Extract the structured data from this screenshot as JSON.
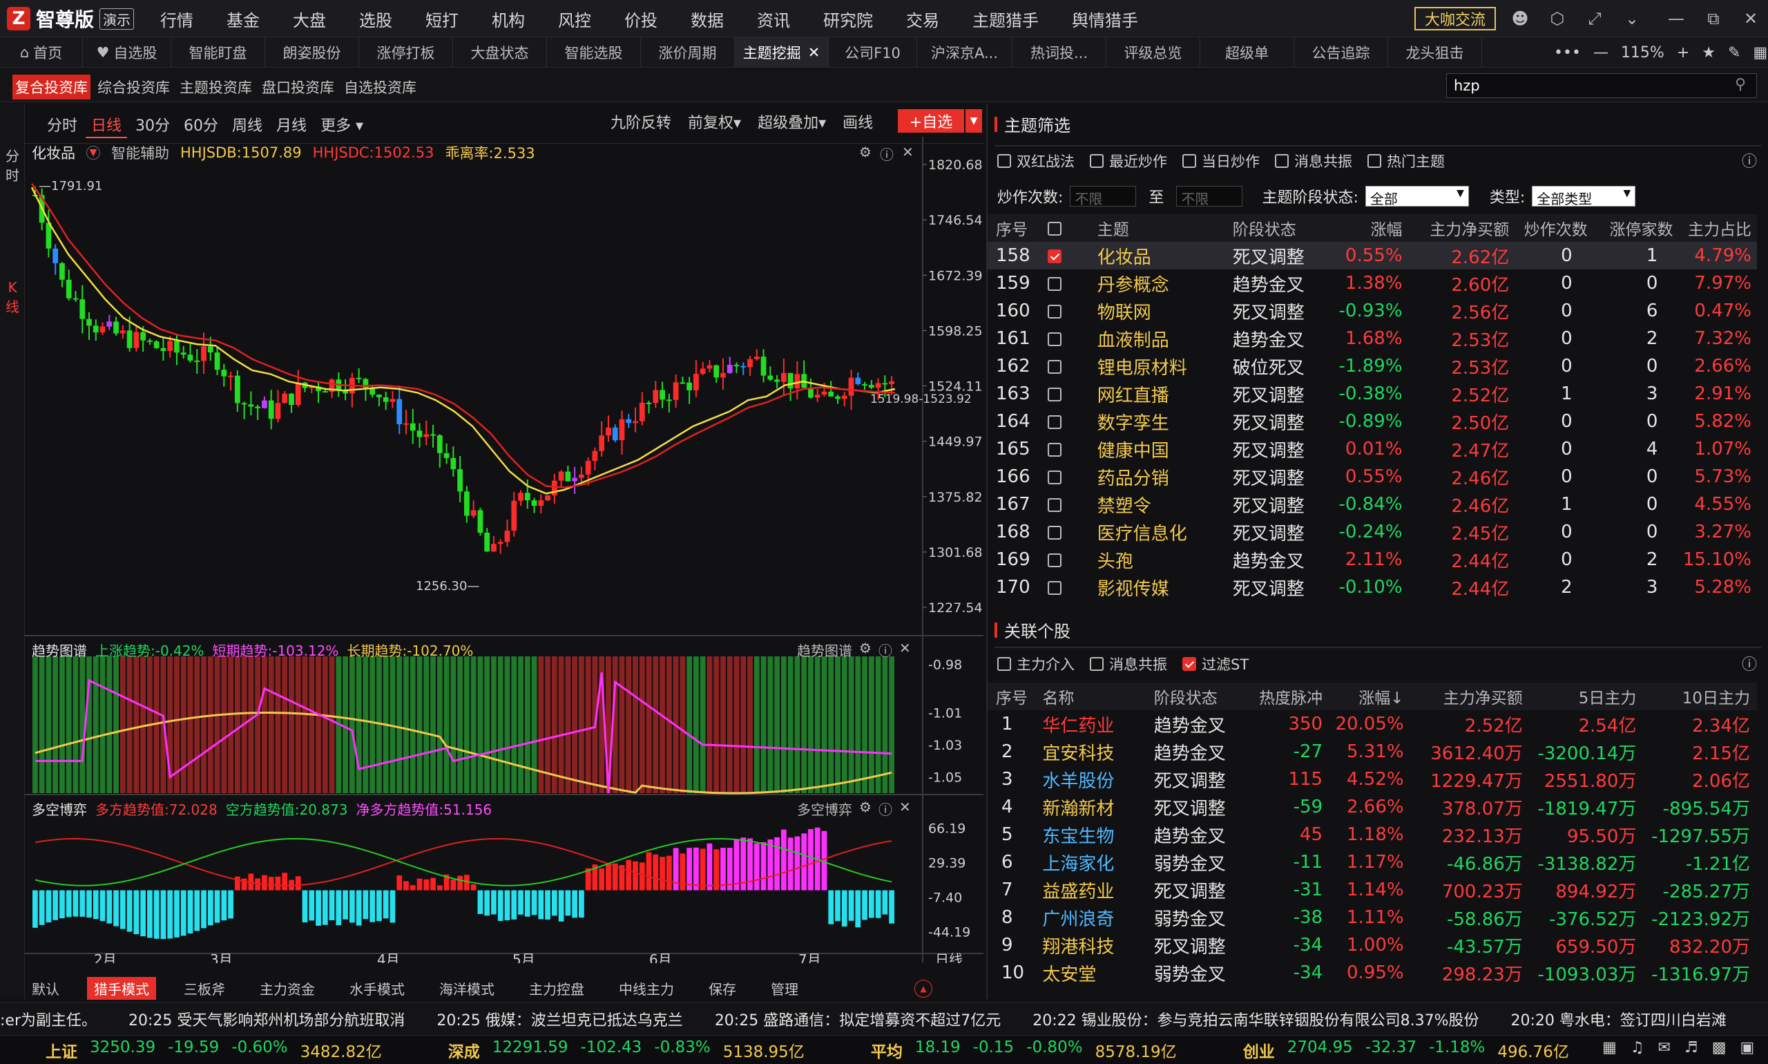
{
  "app": {
    "name": "智尊版",
    "badge": "演示",
    "coffee": "大咖交流"
  },
  "main_menu": [
    "行情",
    "基金",
    "大盘",
    "选股",
    "短打",
    "机构",
    "风控",
    "价投",
    "数据",
    "资讯",
    "研究院",
    "交易",
    "主题猎手",
    "舆情猎手"
  ],
  "tabs": [
    "首页",
    "自选股",
    "智能盯盘",
    "朗姿股份",
    "涨停打板",
    "大盘状态",
    "智能选股",
    "涨价周期",
    "主题挖掘",
    "公司F10",
    "沪深京A...",
    "热词投...",
    "评级总览",
    "超级单",
    "公告追踪",
    "龙头狙击"
  ],
  "active_tab": "主题挖掘",
  "zoom": "115%",
  "lib_tabs": [
    "复合投资库",
    "综合投资库",
    "主题投资库",
    "盘口投资库",
    "自选投资库"
  ],
  "search_value": "hzp",
  "left_labels": {
    "fenshi": "分时",
    "kline": "K线"
  },
  "periods": [
    "分时",
    "日线",
    "30分",
    "60分",
    "周线",
    "月线",
    "更多 ▾"
  ],
  "chart_tools": [
    "九阶反转",
    "前复权▾",
    "超级叠加▾",
    "画线"
  ],
  "add_watch": "+自选",
  "info": {
    "name": "化妆品",
    "assist": "智能辅助",
    "hhjsdb": "HHJSDB:1507.89",
    "hhjsdc": "HHJSDC:1502.53",
    "deviation": "乖离率:2.533"
  },
  "chart_data": [
    {
      "type": "candlestick",
      "title": "化妆品",
      "y_ticks": [
        "1820.68",
        "1746.54",
        "1672.39",
        "1598.25",
        "1524.11",
        "1449.97",
        "1375.82",
        "1301.68",
        "1227.54"
      ],
      "ylim": [
        1210,
        1830
      ],
      "x_ticks": [
        "2月",
        "3月",
        "4月",
        "5月",
        "6月",
        "7月",
        "日线"
      ],
      "annotations": [
        "1791.91",
        "1256.30",
        "1519.98-1523.92"
      ],
      "series": [
        {
          "name": "HHJSDB",
          "points": [
            1790,
            1740,
            1700,
            1670,
            1640,
            1615,
            1600,
            1590,
            1585,
            1580,
            1578,
            1560,
            1545,
            1540,
            1530,
            1525,
            1520,
            1518,
            1520,
            1522,
            1520,
            1515,
            1505,
            1490,
            1470,
            1440,
            1410,
            1390,
            1380,
            1385,
            1395,
            1405,
            1415,
            1425,
            1440,
            1455,
            1470,
            1480,
            1490,
            1505,
            1510,
            1525,
            1530,
            1525,
            1520,
            1518,
            1515,
            1520
          ]
        },
        {
          "name": "HHJSDC",
          "points": [
            1795,
            1760,
            1720,
            1690,
            1660,
            1635,
            1615,
            1600,
            1592,
            1588,
            1585,
            1575,
            1560,
            1550,
            1540,
            1532,
            1528,
            1525,
            1524,
            1525,
            1523,
            1520,
            1512,
            1500,
            1482,
            1460,
            1430,
            1405,
            1390,
            1388,
            1392,
            1400,
            1408,
            1418,
            1430,
            1445,
            1458,
            1470,
            1482,
            1495,
            1502,
            1512,
            1520,
            1522,
            1520,
            1518,
            1516,
            1515
          ]
        }
      ]
    },
    {
      "type": "bar",
      "title": "趋势图谱",
      "legend": [
        "上涨趋势:-0.42%",
        "短期趋势:-103.12%",
        "长期趋势:-102.70%"
      ],
      "y_ticks": [
        "-0.98",
        "-1.01",
        "-1.03",
        "-1.05"
      ]
    },
    {
      "type": "bar",
      "title": "多空博弈",
      "legend": [
        "多方趋势值:72.028",
        "空方趋势值:20.873",
        "净多方趋势值:51.156"
      ],
      "y_ticks": [
        "66.19",
        "29.39",
        "-7.40",
        "-44.19"
      ]
    }
  ],
  "bottom_tabs": [
    "默认",
    "猎手模式",
    "三板斧",
    "主力资金",
    "水手模式",
    "海洋模式",
    "主力控盘",
    "中线主力",
    "保存",
    "管理"
  ],
  "active_bottom_tab": "猎手模式",
  "theme_filter": {
    "title": "主题筛选",
    "checkboxes": [
      "双红战法",
      "最近炒作",
      "当日炒作",
      "消息共振",
      "热门主题"
    ],
    "count_label": "炒作次数:",
    "min_placeholder": "不限",
    "to": "至",
    "max_placeholder": "不限",
    "stage_label": "主题阶段状态:",
    "stage_value": "全部",
    "type_label": "类型:",
    "type_value": "全部类型",
    "headers": [
      "序号",
      "",
      "主题",
      "阶段状态",
      "涨幅",
      "主力净买额",
      "炒作次数",
      "涨停家数",
      "主力占比"
    ],
    "rows": [
      {
        "no": "158",
        "checked": true,
        "name": "化妆品",
        "stage": "死叉调整",
        "chg": "0.55%",
        "net": "2.62亿",
        "times": "0",
        "limit": "1",
        "ratio": "4.79%"
      },
      {
        "no": "159",
        "checked": false,
        "name": "丹参概念",
        "stage": "趋势金叉",
        "chg": "1.38%",
        "net": "2.60亿",
        "times": "0",
        "limit": "0",
        "ratio": "7.97%"
      },
      {
        "no": "160",
        "checked": false,
        "name": "物联网",
        "stage": "死叉调整",
        "chg": "-0.93%",
        "net": "2.56亿",
        "times": "0",
        "limit": "6",
        "ratio": "0.47%"
      },
      {
        "no": "161",
        "checked": false,
        "name": "血液制品",
        "stage": "趋势金叉",
        "chg": "1.68%",
        "net": "2.53亿",
        "times": "0",
        "limit": "2",
        "ratio": "7.32%"
      },
      {
        "no": "162",
        "checked": false,
        "name": "锂电原材料",
        "stage": "破位死叉",
        "chg": "-1.89%",
        "net": "2.53亿",
        "times": "0",
        "limit": "0",
        "ratio": "2.66%"
      },
      {
        "no": "163",
        "checked": false,
        "name": "网红直播",
        "stage": "死叉调整",
        "chg": "-0.38%",
        "net": "2.52亿",
        "times": "1",
        "limit": "3",
        "ratio": "2.91%"
      },
      {
        "no": "164",
        "checked": false,
        "name": "数字孪生",
        "stage": "死叉调整",
        "chg": "-0.89%",
        "net": "2.50亿",
        "times": "0",
        "limit": "0",
        "ratio": "5.82%"
      },
      {
        "no": "165",
        "checked": false,
        "name": "健康中国",
        "stage": "死叉调整",
        "chg": "0.01%",
        "net": "2.47亿",
        "times": "0",
        "limit": "4",
        "ratio": "1.07%"
      },
      {
        "no": "166",
        "checked": false,
        "name": "药品分销",
        "stage": "死叉调整",
        "chg": "0.55%",
        "net": "2.46亿",
        "times": "0",
        "limit": "0",
        "ratio": "5.73%"
      },
      {
        "no": "167",
        "checked": false,
        "name": "禁塑令",
        "stage": "死叉调整",
        "chg": "-0.84%",
        "net": "2.46亿",
        "times": "1",
        "limit": "0",
        "ratio": "4.55%"
      },
      {
        "no": "168",
        "checked": false,
        "name": "医疗信息化",
        "stage": "死叉调整",
        "chg": "-0.24%",
        "net": "2.45亿",
        "times": "0",
        "limit": "0",
        "ratio": "3.27%"
      },
      {
        "no": "169",
        "checked": false,
        "name": "头孢",
        "stage": "趋势金叉",
        "chg": "2.11%",
        "net": "2.44亿",
        "times": "0",
        "limit": "2",
        "ratio": "15.10%"
      },
      {
        "no": "170",
        "checked": false,
        "name": "影视传媒",
        "stage": "死叉调整",
        "chg": "-0.10%",
        "net": "2.44亿",
        "times": "2",
        "limit": "3",
        "ratio": "5.28%"
      }
    ]
  },
  "related": {
    "title": "关联个股",
    "checkboxes": [
      {
        "label": "主力介入",
        "checked": false
      },
      {
        "label": "消息共振",
        "checked": false
      },
      {
        "label": "过滤ST",
        "checked": true
      }
    ],
    "headers": [
      "序号",
      "名称",
      "阶段状态",
      "热度脉冲",
      "涨幅↓",
      "主力净买额",
      "5日主力",
      "10日主力"
    ],
    "rows": [
      {
        "no": "1",
        "name": "华仁药业",
        "stage": "趋势金叉",
        "heat": "350",
        "chg": "20.05%",
        "net": "2.52亿",
        "d5": "2.54亿",
        "d10": "2.34亿"
      },
      {
        "no": "2",
        "name": "宜安科技",
        "stage": "趋势金叉",
        "heat": "-27",
        "chg": "5.31%",
        "net": "3612.40万",
        "d5": "-3200.14万",
        "d10": "2.15亿"
      },
      {
        "no": "3",
        "name": "水羊股份",
        "stage": "死叉调整",
        "heat": "115",
        "chg": "4.52%",
        "net": "1229.47万",
        "d5": "2551.80万",
        "d10": "2.06亿"
      },
      {
        "no": "4",
        "name": "新瀚新材",
        "stage": "死叉调整",
        "heat": "-59",
        "chg": "2.66%",
        "net": "378.07万",
        "d5": "-1819.47万",
        "d10": "-895.54万"
      },
      {
        "no": "5",
        "name": "东宝生物",
        "stage": "趋势金叉",
        "heat": "45",
        "chg": "1.18%",
        "net": "232.13万",
        "d5": "95.50万",
        "d10": "-1297.55万"
      },
      {
        "no": "6",
        "name": "上海家化",
        "stage": "弱势金叉",
        "heat": "-11",
        "chg": "1.17%",
        "net": "-46.86万",
        "d5": "-3138.82万",
        "d10": "-1.21亿"
      },
      {
        "no": "7",
        "name": "益盛药业",
        "stage": "死叉调整",
        "heat": "-31",
        "chg": "1.14%",
        "net": "700.23万",
        "d5": "894.92万",
        "d10": "-285.27万"
      },
      {
        "no": "8",
        "name": "广州浪奇",
        "stage": "弱势金叉",
        "heat": "-38",
        "chg": "1.11%",
        "net": "-58.86万",
        "d5": "-376.52万",
        "d10": "-2123.92万"
      },
      {
        "no": "9",
        "name": "翔港科技",
        "stage": "死叉调整",
        "heat": "-34",
        "chg": "1.00%",
        "net": "-43.57万",
        "d5": "659.50万",
        "d10": "832.20万"
      },
      {
        "no": "10",
        "name": "太安堂",
        "stage": "弱势金叉",
        "heat": "-34",
        "chg": "0.95%",
        "net": "298.23万",
        "d5": "-1093.03万",
        "d10": "-1316.97万"
      }
    ]
  },
  "news": [
    ":er为副主任。",
    "20:25 受天气影响郑州机场部分航班取消",
    "20:25 俄媒：波兰坦克已抵达乌克兰",
    "20:25 盛路通信：拟定增募资不超过7亿元",
    "20:22 锡业股份：参与竞拍云南华联锌铟股份有限公司8.37%股份",
    "20:20 粤水电：签订四川白岩滩"
  ],
  "indices": [
    {
      "name": "上证",
      "price": "3250.39",
      "chg": "-19.59",
      "pct": "-0.60%",
      "amt": "3482.82亿"
    },
    {
      "name": "深成",
      "price": "12291.59",
      "chg": "-102.43",
      "pct": "-0.83%",
      "amt": "5138.95亿"
    },
    {
      "name": "平均",
      "price": "18.19",
      "chg": "-0.15",
      "pct": "-0.80%",
      "amt": "8578.19亿"
    },
    {
      "name": "创业",
      "price": "2704.95",
      "chg": "-32.37",
      "pct": "-1.18%",
      "amt": "496.76亿"
    }
  ],
  "colors": {
    "up": "#ff3b3b",
    "down": "#1ed760",
    "accent": "#e8302a",
    "gold": "#f2c94c"
  }
}
